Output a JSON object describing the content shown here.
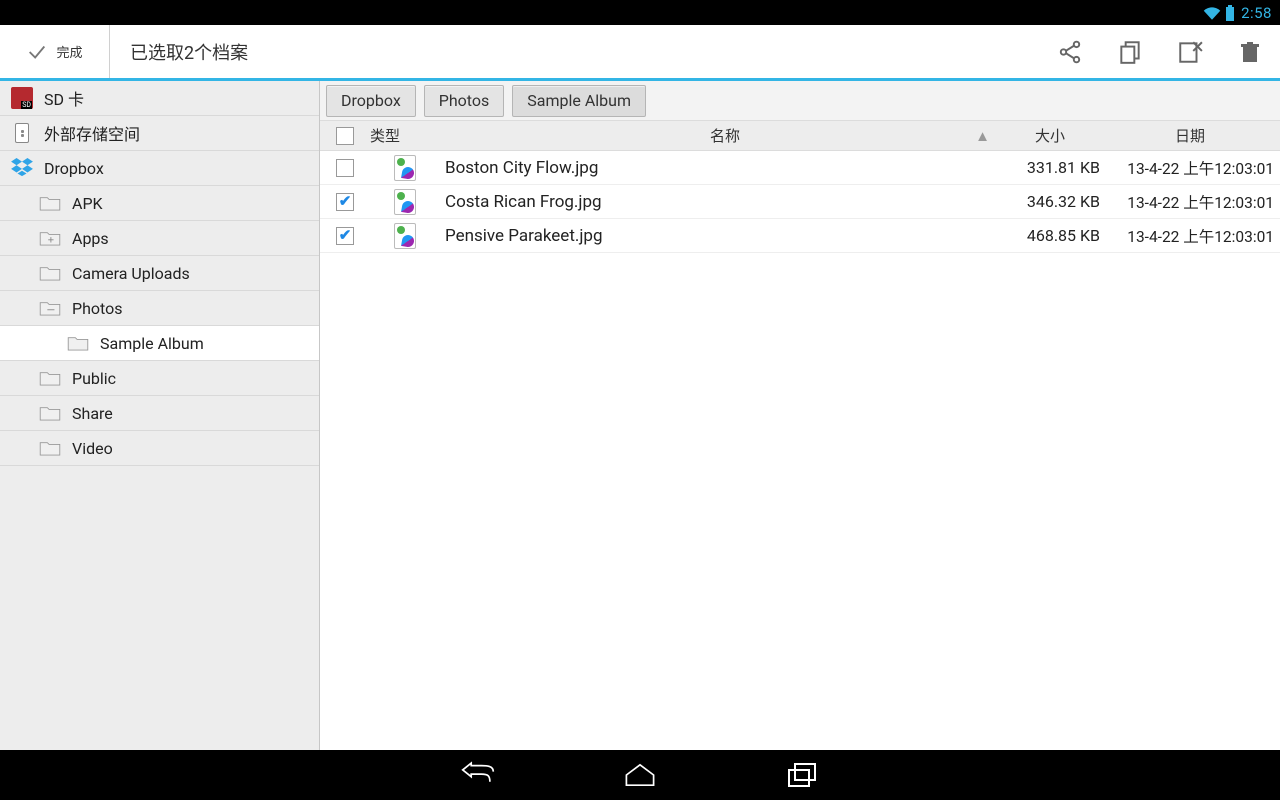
{
  "status": {
    "time": "2:58"
  },
  "actionbar": {
    "done_label": "完成",
    "title": "已选取2个档案"
  },
  "sidebar": {
    "items": [
      {
        "label": "SD 卡"
      },
      {
        "label": "外部存储空间"
      },
      {
        "label": "Dropbox"
      },
      {
        "label": "APK"
      },
      {
        "label": "Apps"
      },
      {
        "label": "Camera Uploads"
      },
      {
        "label": "Photos"
      },
      {
        "label": "Sample Album"
      },
      {
        "label": "Public"
      },
      {
        "label": "Share"
      },
      {
        "label": "Video"
      }
    ]
  },
  "breadcrumbs": [
    "Dropbox",
    "Photos",
    "Sample Album"
  ],
  "columns": {
    "type": "类型",
    "name": "名称",
    "size": "大小",
    "date": "日期"
  },
  "files": [
    {
      "checked": false,
      "name": "Boston City Flow.jpg",
      "size": "331.81 KB",
      "date": "13-4-22 上午12:03:01"
    },
    {
      "checked": true,
      "name": "Costa Rican Frog.jpg",
      "size": "346.32 KB",
      "date": "13-4-22 上午12:03:01"
    },
    {
      "checked": true,
      "name": "Pensive Parakeet.jpg",
      "size": "468.85 KB",
      "date": "13-4-22 上午12:03:01"
    }
  ]
}
